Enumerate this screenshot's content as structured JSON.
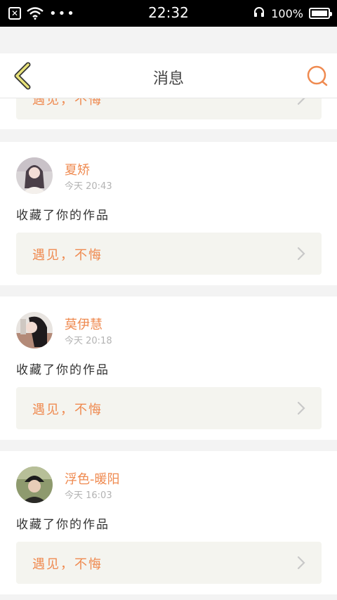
{
  "status_bar": {
    "time": "22:32",
    "battery": "100%",
    "battery_level": 1.0,
    "icons": [
      "close-notification-icon",
      "wifi-icon",
      "more-dots-icon",
      "headphones-icon",
      "battery-icon"
    ]
  },
  "header": {
    "title": "消息",
    "back_icon": "chevron-left-icon",
    "search_icon": "search-icon",
    "accent": "#ef8a50",
    "back_color": "#e8e27a"
  },
  "partial_card": {
    "work_title": "遇见，不悔"
  },
  "messages": [
    {
      "user": "夏矫",
      "time": "今天 20:43",
      "action": "收藏了你的作品",
      "work_title": "遇见，不悔"
    },
    {
      "user": "莫伊慧",
      "time": "今天 20:18",
      "action": "收藏了你的作品",
      "work_title": "遇见，不悔"
    },
    {
      "user": "浮色-暖阳",
      "time": "今天 16:03",
      "action": "收藏了你的作品",
      "work_title": "遇见，不悔"
    }
  ]
}
